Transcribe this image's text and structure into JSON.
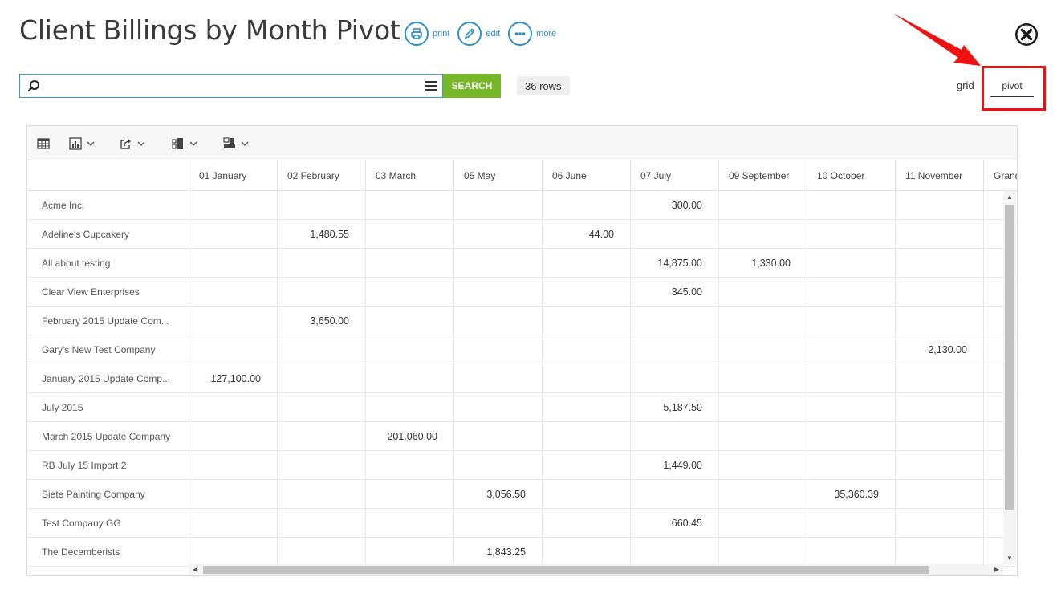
{
  "title": "Client Billings by Month Pivot",
  "actions": [
    {
      "label": "print",
      "icon": "printer-icon"
    },
    {
      "label": "edit",
      "icon": "pencil-icon"
    },
    {
      "label": "more",
      "icon": "ellipsis-icon"
    }
  ],
  "search": {
    "value": "",
    "placeholder": "",
    "button_label": "SEARCH"
  },
  "row_count": "36 rows",
  "view_switch": {
    "grid": "grid",
    "pivot": "pivot",
    "selected": "pivot"
  },
  "colors": {
    "accent": "#2c8fc9",
    "search_button": "#76b82a",
    "annotation": "#ee1111"
  },
  "pivot": {
    "columns": [
      "01 January",
      "02 February",
      "03 March",
      "05 May",
      "06 June",
      "07 July",
      "09 September",
      "10 October",
      "11 November",
      "Grand"
    ],
    "rows": [
      {
        "label": "Acme Inc.",
        "cells": [
          "",
          "",
          "",
          "",
          "",
          "300.00",
          "",
          "",
          "",
          ""
        ]
      },
      {
        "label": "Adeline's Cupcakery",
        "cells": [
          "",
          "1,480.55",
          "",
          "",
          "44.00",
          "",
          "",
          "",
          "",
          ""
        ]
      },
      {
        "label": "All about testing",
        "cells": [
          "",
          "",
          "",
          "",
          "",
          "14,875.00",
          "1,330.00",
          "",
          "",
          ""
        ]
      },
      {
        "label": "Clear View Enterprises",
        "cells": [
          "",
          "",
          "",
          "",
          "",
          "345.00",
          "",
          "",
          "",
          ""
        ]
      },
      {
        "label": "February 2015 Update Com...",
        "cells": [
          "",
          "3,650.00",
          "",
          "",
          "",
          "",
          "",
          "",
          "",
          ""
        ]
      },
      {
        "label": "Gary's New Test Company",
        "cells": [
          "",
          "",
          "",
          "",
          "",
          "",
          "",
          "",
          "2,130.00",
          ""
        ]
      },
      {
        "label": "January 2015 Update Comp...",
        "cells": [
          "127,100.00",
          "",
          "",
          "",
          "",
          "",
          "",
          "",
          "",
          ""
        ]
      },
      {
        "label": "July 2015",
        "cells": [
          "",
          "",
          "",
          "",
          "",
          "5,187.50",
          "",
          "",
          "",
          ""
        ]
      },
      {
        "label": "March 2015 Update Company",
        "cells": [
          "",
          "",
          "201,060.00",
          "",
          "",
          "",
          "",
          "",
          "",
          ""
        ]
      },
      {
        "label": "RB July 15 Import 2",
        "cells": [
          "",
          "",
          "",
          "",
          "",
          "1,449.00",
          "",
          "",
          "",
          ""
        ]
      },
      {
        "label": "Siete Painting Company",
        "cells": [
          "",
          "",
          "",
          "3,056.50",
          "",
          "",
          "",
          "35,360.39",
          "",
          ""
        ]
      },
      {
        "label": "Test Company GG",
        "cells": [
          "",
          "",
          "",
          "",
          "",
          "660.45",
          "",
          "",
          "",
          ""
        ]
      },
      {
        "label": "The Decemberists",
        "cells": [
          "",
          "",
          "",
          "1,843.25",
          "",
          "",
          "",
          "",
          "",
          ""
        ]
      }
    ]
  }
}
